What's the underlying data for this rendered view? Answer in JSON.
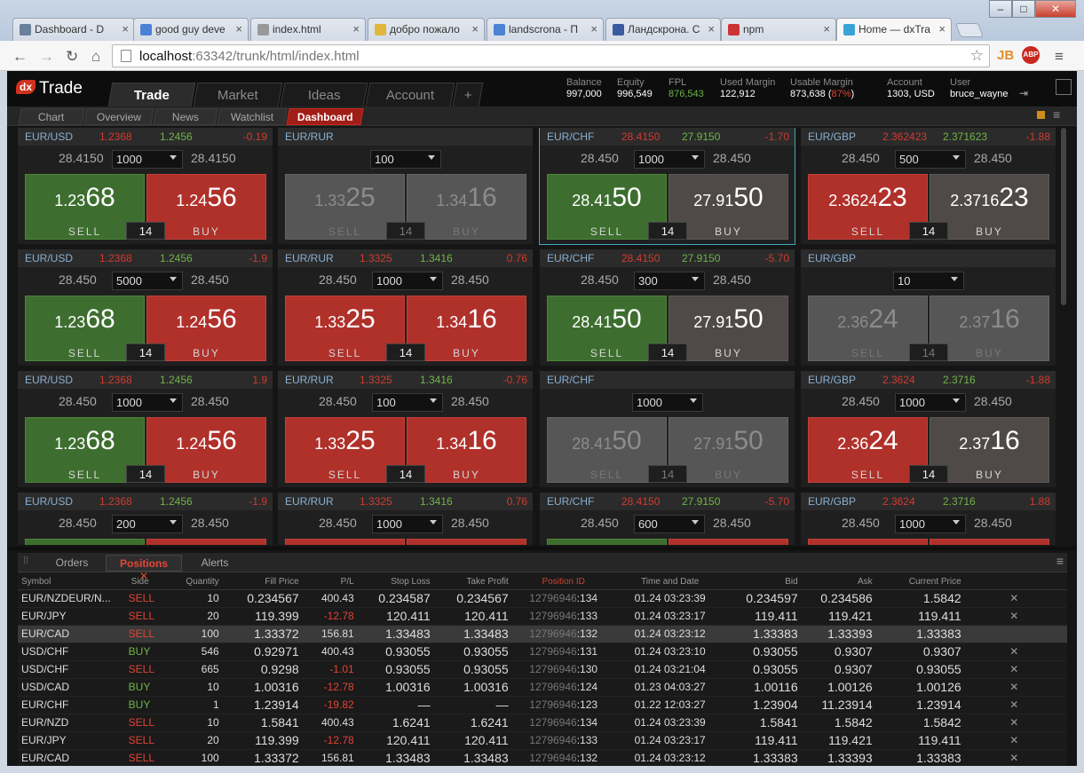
{
  "browser": {
    "tabs": [
      {
        "title": "Dashboard - D",
        "fav": "#6a7f9a"
      },
      {
        "title": "good guy deve",
        "fav": "#4b82d4"
      },
      {
        "title": "index.html",
        "fav": "#999999"
      },
      {
        "title": "добро пожало",
        "fav": "#e0b73a"
      },
      {
        "title": "landscrona - П",
        "fav": "#4b82d4"
      },
      {
        "title": "Ландскрона. С",
        "fav": "#3a5ba0"
      },
      {
        "title": "npm",
        "fav": "#c33"
      },
      {
        "title": "Home — dxTra",
        "fav": "#3aa3d6"
      }
    ],
    "url_host": "localhost",
    "url_rest": ":63342/trunk/html/index.html",
    "window_controls": [
      "–",
      "□",
      "✕"
    ]
  },
  "app": {
    "logo_mark": "dx",
    "logo_text": "Trade",
    "main_tabs": [
      "Trade",
      "Market",
      "Ideas",
      "Account",
      "+"
    ],
    "stats": [
      {
        "k": "Balance",
        "v": "997,000"
      },
      {
        "k": "Equity",
        "v": "996,549"
      },
      {
        "k": "FPL",
        "v": "876,543"
      },
      {
        "k": "Used Margin",
        "v": "122,912"
      },
      {
        "k": "Usable Margin",
        "v": "873,638 (",
        "pct": "87%",
        "tail": ")"
      },
      {
        "k": "Account",
        "v": "1303, USD"
      },
      {
        "k": "User",
        "v": "bruce_wayne"
      }
    ],
    "sub_tabs": [
      "Chart",
      "Overview",
      "News",
      "Watchlist",
      "Dashboard"
    ]
  },
  "cards": [
    {
      "sym": "EUR/USD",
      "p1": "1.2368",
      "p2": "1.2456",
      "chg": "-0.19",
      "neg": true,
      "lp": "28.4150",
      "rp": "28.4150",
      "qty": "1000",
      "sell": [
        "1.23",
        "68"
      ],
      "buy": [
        "1.24",
        "56"
      ],
      "spread": "14",
      "style": ""
    },
    {
      "sym": "EUR/RUR",
      "p1": "",
      "p2": "",
      "chg": "",
      "neg": false,
      "lp": "",
      "rp": "",
      "qty": "100",
      "sell": [
        "1.33",
        "25"
      ],
      "buy": [
        "1.34",
        "16"
      ],
      "spread": "14",
      "style": "dim"
    },
    {
      "sym": "EUR/CHF",
      "p1": "28.4150",
      "p2": "27.9150",
      "chg": "-1.70",
      "neg": true,
      "lp": "28.450",
      "rp": "28.450",
      "qty": "1000",
      "sell": [
        "28.41",
        "50"
      ],
      "buy": [
        "27.91",
        "50"
      ],
      "spread": "14",
      "style": "dark sel"
    },
    {
      "sym": "EUR/GBP",
      "p1": "2.362423",
      "p2": "2.371623",
      "chg": "-1.88",
      "neg": true,
      "lp": "28.450",
      "rp": "28.450",
      "qty": "500",
      "sell": [
        "2.3624",
        "23"
      ],
      "buy": [
        "2.3716",
        "23"
      ],
      "spread": "14",
      "style": "dark2"
    },
    {
      "sym": "EUR/USD",
      "p1": "1.2368",
      "p2": "1.2456",
      "chg": "-1.9",
      "neg": true,
      "lp": "28.450",
      "rp": "28.450",
      "qty": "5000",
      "sell": [
        "1.23",
        "68"
      ],
      "buy": [
        "1.24",
        "56"
      ],
      "spread": "14",
      "style": ""
    },
    {
      "sym": "EUR/RUR",
      "p1": "1.3325",
      "p2": "1.3416",
      "chg": "0.76",
      "neg": true,
      "lp": "28.450",
      "rp": "28.450",
      "qty": "1000",
      "sell": [
        "1.33",
        "25"
      ],
      "buy": [
        "1.34",
        "16"
      ],
      "spread": "14",
      "style": "red"
    },
    {
      "sym": "EUR/CHF",
      "p1": "28.4150",
      "p2": "27.9150",
      "chg": "-5.70",
      "neg": true,
      "lp": "28.450",
      "rp": "28.450",
      "qty": "300",
      "sell": [
        "28.41",
        "50"
      ],
      "buy": [
        "27.91",
        "50"
      ],
      "spread": "14",
      "style": "dark"
    },
    {
      "sym": "EUR/GBP",
      "p1": "",
      "p2": "",
      "chg": "",
      "neg": false,
      "lp": "",
      "rp": "",
      "qty": "10",
      "sell": [
        "2.36",
        "24"
      ],
      "buy": [
        "2.37",
        "16"
      ],
      "spread": "14",
      "style": "dim"
    },
    {
      "sym": "EUR/USD",
      "p1": "1.2368",
      "p2": "1.2456",
      "chg": "1.9",
      "neg": true,
      "lp": "28.450",
      "rp": "28.450",
      "qty": "1000",
      "sell": [
        "1.23",
        "68"
      ],
      "buy": [
        "1.24",
        "56"
      ],
      "spread": "14",
      "style": ""
    },
    {
      "sym": "EUR/RUR",
      "p1": "1.3325",
      "p2": "1.3416",
      "chg": "-0.76",
      "neg": true,
      "lp": "28.450",
      "rp": "28.450",
      "qty": "100",
      "sell": [
        "1.33",
        "25"
      ],
      "buy": [
        "1.34",
        "16"
      ],
      "spread": "14",
      "style": "red"
    },
    {
      "sym": "EUR/CHF",
      "p1": "",
      "p2": "",
      "chg": "",
      "neg": false,
      "lp": "",
      "rp": "",
      "qty": "1000",
      "sell": [
        "28.41",
        "50"
      ],
      "buy": [
        "27.91",
        "50"
      ],
      "spread": "14",
      "style": "dim"
    },
    {
      "sym": "EUR/GBP",
      "p1": "2.3624",
      "p2": "2.3716",
      "chg": "-1.88",
      "neg": true,
      "lp": "28.450",
      "rp": "28.450",
      "qty": "1000",
      "sell": [
        "2.36",
        "24"
      ],
      "buy": [
        "2.37",
        "16"
      ],
      "spread": "14",
      "style": "dark2b"
    },
    {
      "sym": "EUR/USD",
      "p1": "1.2368",
      "p2": "1.2456",
      "chg": "-1.9",
      "neg": true,
      "lp": "28.450",
      "rp": "28.450",
      "qty": "200",
      "sell": [
        "",
        ""
      ],
      "buy": [
        "",
        ""
      ],
      "spread": "",
      "style": ""
    },
    {
      "sym": "EUR/RUR",
      "p1": "1.3325",
      "p2": "1.3416",
      "chg": "0.76",
      "neg": true,
      "lp": "28.450",
      "rp": "28.450",
      "qty": "1000",
      "sell": [
        "",
        ""
      ],
      "buy": [
        "",
        ""
      ],
      "spread": "",
      "style": "red"
    },
    {
      "sym": "EUR/CHF",
      "p1": "28.4150",
      "p2": "27.9150",
      "chg": "-5.70",
      "neg": true,
      "lp": "28.450",
      "rp": "28.450",
      "qty": "600",
      "sell": [
        "",
        ""
      ],
      "buy": [
        "",
        ""
      ],
      "spread": "",
      "style": ""
    },
    {
      "sym": "EUR/GBP",
      "p1": "2.3624",
      "p2": "2.3716",
      "chg": "1.88",
      "neg": true,
      "lp": "28.450",
      "rp": "28.450",
      "qty": "1000",
      "sell": [
        "",
        ""
      ],
      "buy": [
        "",
        ""
      ],
      "spread": "",
      "style": "red"
    }
  ],
  "button_labels": {
    "sell": "SELL",
    "buy": "BUY"
  },
  "bottom_tabs": [
    "Orders",
    "Positions",
    "Alerts"
  ],
  "columns": [
    "Symbol",
    "Side",
    "Quantity",
    "Fill Price",
    "P/L",
    "Stop Loss",
    "Take Profit",
    "Position ID",
    "Time and Date",
    "Bid",
    "Ask",
    "Current Price"
  ],
  "positions": [
    {
      "sym": "EUR/NZDEUR/N...",
      "side": "SELL",
      "qty": "10",
      "fill": "0.234567",
      "pl": "400.43",
      "plneg": false,
      "sl": "0.234587",
      "tp": "0.234567",
      "pid1": "12796946",
      "pid2": ":134",
      "time": "01.24 03:23:39",
      "bid": "0.234597",
      "ask": "0.234586",
      "cur": "1.5842",
      "x": "✕"
    },
    {
      "sym": "EUR/JPY",
      "side": "SELL",
      "qty": "20",
      "fill": "119.399",
      "pl": "-12.78",
      "plneg": true,
      "sl": "120.411",
      "tp": "120.411",
      "pid1": "12796946",
      "pid2": ":133",
      "time": "01.24 03:23:17",
      "bid": "119.411",
      "ask": "119.421",
      "cur": "119.411",
      "x": "✕"
    },
    {
      "sym": "EUR/CAD",
      "side": "SELL",
      "qty": "100",
      "fill": "1.33372",
      "pl": "156.81",
      "plneg": false,
      "sl": "1.33483",
      "tp": "1.33483",
      "pid1": "12796946",
      "pid2": ":132",
      "time": "01.24 03:23:12",
      "bid": "1.33383",
      "ask": "1.33393",
      "cur": "1.33383",
      "x": "",
      "hl": true
    },
    {
      "sym": "USD/CHF",
      "side": "BUY",
      "qty": "546",
      "fill": "0.92971",
      "pl": "400.43",
      "plneg": false,
      "sl": "0.93055",
      "tp": "0.93055",
      "pid1": "12796946",
      "pid2": ":131",
      "time": "01.24 03:23:10",
      "bid": "0.93055",
      "ask": "0.9307",
      "cur": "0.9307",
      "x": "✕"
    },
    {
      "sym": "USD/CHF",
      "side": "SELL",
      "qty": "665",
      "fill": "0.9298",
      "pl": "-1.01",
      "plneg": true,
      "sl": "0.93055",
      "tp": "0.93055",
      "pid1": "12796946",
      "pid2": ":130",
      "time": "01.24 03:21:04",
      "bid": "0.93055",
      "ask": "0.9307",
      "cur": "0.93055",
      "x": "✕"
    },
    {
      "sym": "USD/CAD",
      "side": "BUY",
      "qty": "10",
      "fill": "1.00316",
      "pl": "-12.78",
      "plneg": true,
      "sl": "1.00316",
      "tp": "1.00316",
      "pid1": "12796946",
      "pid2": ":124",
      "time": "01.23 04:03:27",
      "bid": "1.00116",
      "ask": "1.00126",
      "cur": "1.00126",
      "x": "✕"
    },
    {
      "sym": "EUR/CHF",
      "side": "BUY",
      "qty": "1",
      "fill": "1.23914",
      "pl": "-19.82",
      "plneg": true,
      "sl": "—",
      "tp": "—",
      "pid1": "12796946",
      "pid2": ":123",
      "time": "01.22 12:03:27",
      "bid": "1.23904",
      "ask": "11.23914",
      "cur": "1.23914",
      "x": "✕"
    },
    {
      "sym": "EUR/NZD",
      "side": "SELL",
      "qty": "10",
      "fill": "1.5841",
      "pl": "400.43",
      "plneg": false,
      "sl": "1.6241",
      "tp": "1.6241",
      "pid1": "12796946",
      "pid2": ":134",
      "time": "01.24 03:23:39",
      "bid": "1.5841",
      "ask": "1.5842",
      "cur": "1.5842",
      "x": "✕"
    },
    {
      "sym": "EUR/JPY",
      "side": "SELL",
      "qty": "20",
      "fill": "119.399",
      "pl": "-12.78",
      "plneg": true,
      "sl": "120.411",
      "tp": "120.411",
      "pid1": "12796946",
      "pid2": ":133",
      "time": "01.24 03:23:17",
      "bid": "119.411",
      "ask": "119.421",
      "cur": "119.411",
      "x": "✕"
    },
    {
      "sym": "EUR/CAD",
      "side": "SELL",
      "qty": "100",
      "fill": "1.33372",
      "pl": "156.81",
      "plneg": false,
      "sl": "1.33483",
      "tp": "1.33483",
      "pid1": "12796946",
      "pid2": ":132",
      "time": "01.24 03:23:12",
      "bid": "1.33383",
      "ask": "1.33393",
      "cur": "1.33383",
      "x": "✕"
    }
  ]
}
